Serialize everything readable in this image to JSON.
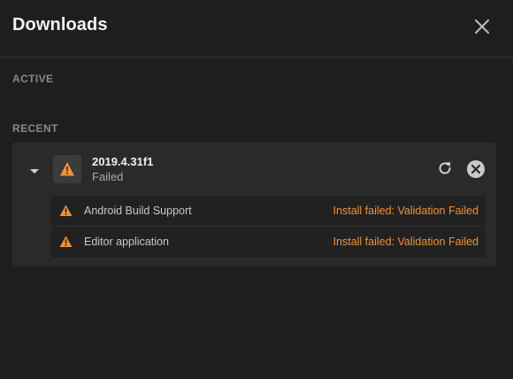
{
  "header": {
    "title": "Downloads"
  },
  "sections": {
    "active_label": "ACTIVE",
    "recent_label": "RECENT"
  },
  "recent": {
    "version": "2019.4.31f1",
    "status": "Failed",
    "items": [
      {
        "name": "Android Build Support",
        "error": "Install failed: Validation Failed"
      },
      {
        "name": "Editor application",
        "error": "Install failed: Validation Failed"
      }
    ]
  },
  "colors": {
    "background": "#1e1e1e",
    "card": "#2a2a2a",
    "warning": "#f0913a",
    "muted_label": "#8a8a8a"
  },
  "icons": {
    "close": "close-icon",
    "expand": "chevron-down-icon",
    "warning": "warning-icon",
    "retry": "retry-icon",
    "cancel": "cancel-circle-icon"
  }
}
